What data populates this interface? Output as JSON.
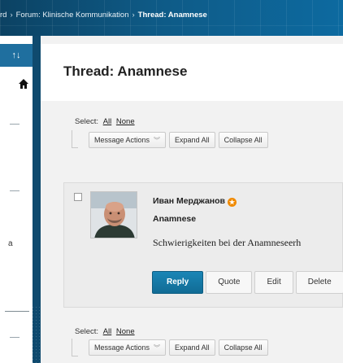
{
  "breadcrumb": {
    "items": [
      "rd",
      "Forum: Klinische Kommunikation",
      "Thread: Anamnese"
    ],
    "separator": "›"
  },
  "left_nav": {
    "sort_label": "↑↓",
    "item_label": "a"
  },
  "thread": {
    "title": "Thread: Anamnese"
  },
  "toolbar_top": {
    "select_label": "Select:",
    "all_label": "All",
    "none_label": "None",
    "message_actions_label": "Message Actions",
    "expand_all_label": "Expand All",
    "collapse_all_label": "Collapse All"
  },
  "toolbar_bottom": {
    "select_label": "Select:",
    "all_label": "All",
    "none_label": "None",
    "message_actions_label": "Message Actions",
    "expand_all_label": "Expand All",
    "collapse_all_label": "Collapse All"
  },
  "message": {
    "author": "Иван Мерджанов",
    "subject": "Anamnese",
    "body": "Schwierigkeiten bei der Anamneseerh",
    "actions": {
      "reply": "Reply",
      "quote": "Quote",
      "edit": "Edit",
      "delete": "Delete"
    }
  },
  "colors": {
    "accent": "#1a86b6",
    "header_bg": "#0f4a6e",
    "badge": "#f08a00"
  }
}
